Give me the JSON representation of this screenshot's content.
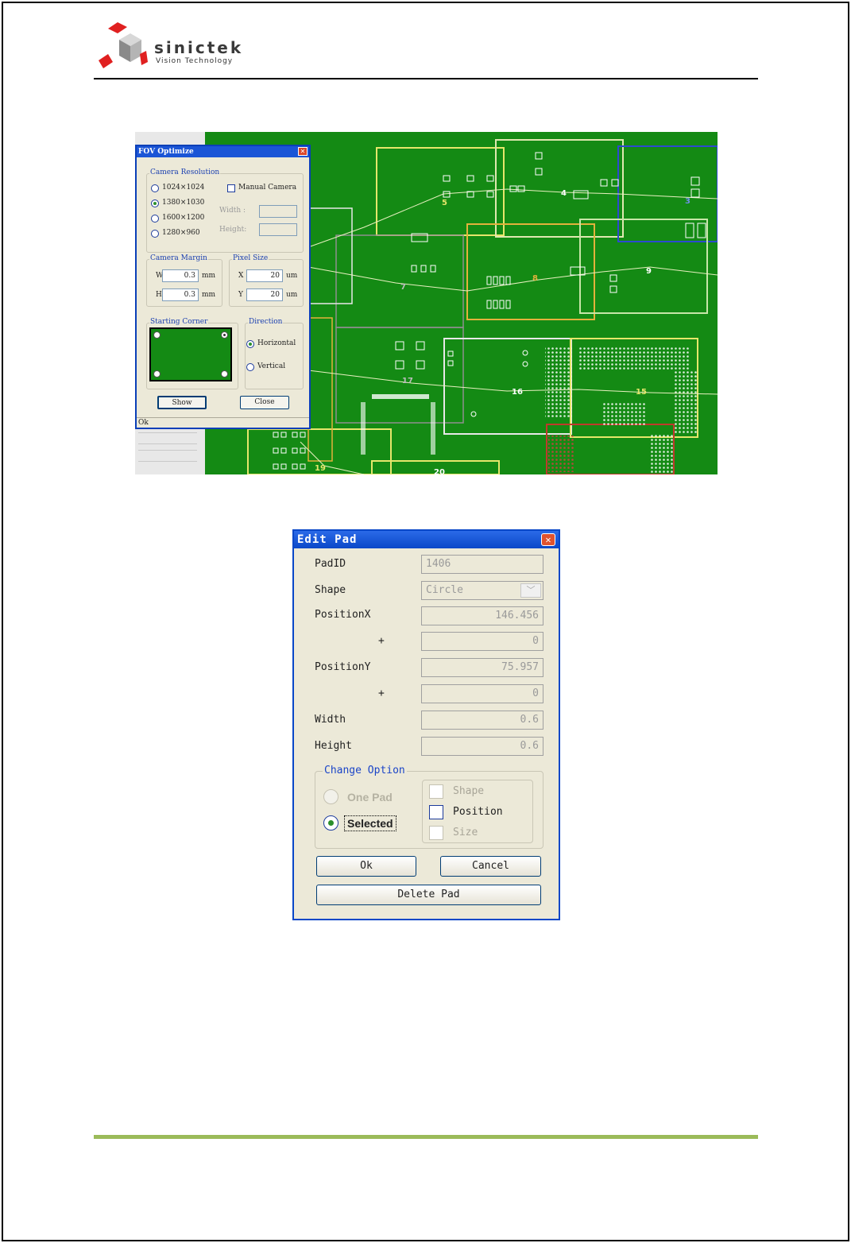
{
  "header": {
    "brand_name": "sinictek",
    "brand_tagline": "Vision Technology",
    "colors": {
      "logo_red": "#e02020",
      "logo_gray": "#9a9a9a",
      "footer_rule": "#9bbb59"
    }
  },
  "fov_screenshot": {
    "board_color": "#148a14",
    "fov_labels": [
      "5",
      "4",
      "3",
      "7",
      "8",
      "9",
      "17",
      "16",
      "15",
      "19",
      "20"
    ],
    "window": {
      "title": "FOV Optimize",
      "camera_resolution": {
        "label": "Camera Resolution",
        "options": [
          "1024×1024",
          "1380×1030",
          "1600×1200",
          "1280×960"
        ],
        "selected": "1380×1030",
        "manual_camera_label": "Manual Camera",
        "width_label": "Width :",
        "height_label": "Height:"
      },
      "camera_margin": {
        "label": "Camera Margin",
        "w_label": "W",
        "w_value": "0.3",
        "h_label": "H",
        "h_value": "0.3",
        "unit": "mm"
      },
      "pixel_size": {
        "label": "Pixel Size",
        "x_label": "X",
        "x_value": "20",
        "y_label": "Y",
        "y_value": "20",
        "unit": "um"
      },
      "starting_corner": {
        "label": "Starting Corner"
      },
      "direction": {
        "label": "Direction",
        "options": [
          "Horizontal",
          "Vertical"
        ],
        "selected": "Horizontal"
      },
      "show_button": "Show",
      "close_button": "Close",
      "status": "Ok"
    }
  },
  "edit_pad": {
    "title": "Edit Pad",
    "fields": {
      "pad_id_label": "PadID",
      "pad_id_value": "1406",
      "shape_label": "Shape",
      "shape_value": "Circle",
      "position_x_label": "PositionX",
      "position_x_value": "146.456",
      "position_x_offset_label": "+",
      "position_x_offset_value": "0",
      "position_y_label": "PositionY",
      "position_y_value": "75.957",
      "position_y_offset_label": "+",
      "position_y_offset_value": "0",
      "width_label": "Width",
      "width_value": "0.6",
      "height_label": "Height",
      "height_value": "0.6"
    },
    "change_option": {
      "label": "Change Option",
      "one_pad_label": "One Pad",
      "selected_label": "Selected",
      "selected_option": "Selected",
      "shape_label": "Shape",
      "position_label": "Position",
      "size_label": "Size"
    },
    "ok_button": "Ok",
    "cancel_button": "Cancel",
    "delete_button": "Delete Pad"
  }
}
